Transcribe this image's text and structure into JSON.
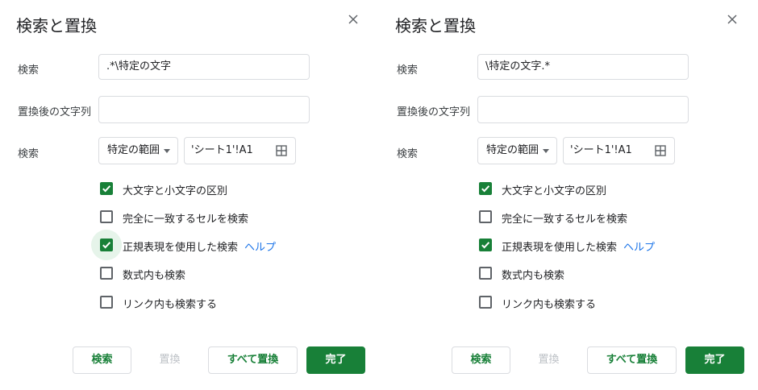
{
  "dialogs": [
    {
      "title": "検索と置換",
      "search_label": "検索",
      "search_value": ".*\\特定の文字",
      "replace_label": "置換後の文字列",
      "replace_value": "",
      "scope_label": "検索",
      "scope_value": "特定の範囲",
      "range_value": "'シート1'!A1",
      "options": [
        {
          "label": "大文字と小文字の区別",
          "checked": true
        },
        {
          "label": "完全に一致するセルを検索",
          "checked": false
        },
        {
          "label": "正規表現を使用した検索",
          "checked": true,
          "help": "ヘルプ"
        },
        {
          "label": "数式内も検索",
          "checked": false
        },
        {
          "label": "リンク内も検索する",
          "checked": false
        }
      ],
      "buttons": {
        "find": "検索",
        "replace": "置換",
        "replace_all": "すべて置換",
        "done": "完了"
      }
    },
    {
      "title": "検索と置換",
      "search_label": "検索",
      "search_value": "\\特定の文字.*",
      "replace_label": "置換後の文字列",
      "replace_value": "",
      "scope_label": "検索",
      "scope_value": "特定の範囲",
      "range_value": "'シート1'!A1",
      "options": [
        {
          "label": "大文字と小文字の区別",
          "checked": true
        },
        {
          "label": "完全に一致するセルを検索",
          "checked": false
        },
        {
          "label": "正規表現を使用した検索",
          "checked": true,
          "help": "ヘルプ"
        },
        {
          "label": "数式内も検索",
          "checked": false
        },
        {
          "label": "リンク内も検索する",
          "checked": false
        }
      ],
      "buttons": {
        "find": "検索",
        "replace": "置換",
        "replace_all": "すべて置換",
        "done": "完了"
      }
    }
  ],
  "icons": {
    "close": "close-icon",
    "range": "grid-icon",
    "check": "checkmark-icon"
  },
  "colors": {
    "accent": "#188038",
    "link": "#1a73e8",
    "border": "#dadce0",
    "disabled": "#bdc1c6"
  }
}
